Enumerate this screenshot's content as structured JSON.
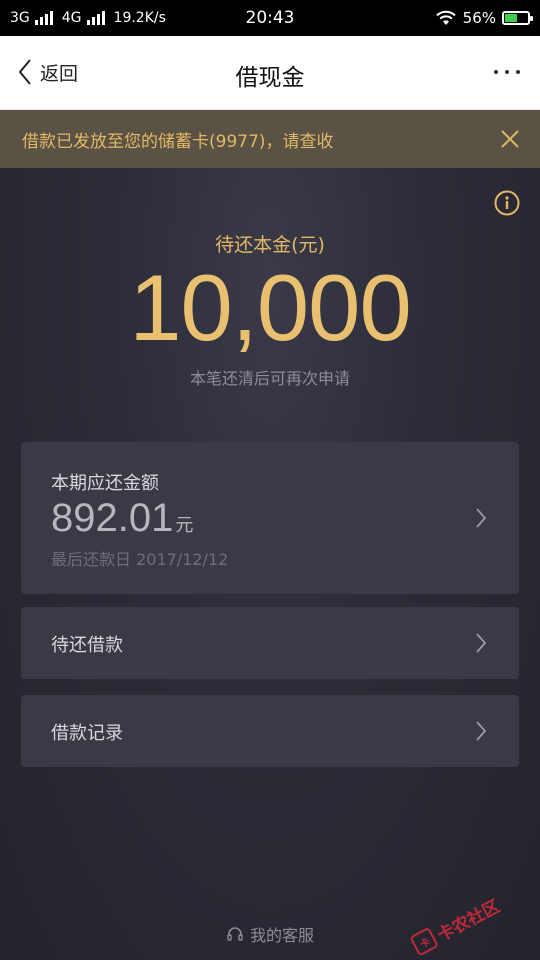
{
  "status_bar": {
    "network_left": "3G",
    "network_right": "4G",
    "speed": "19.2K/s",
    "time": "20:43",
    "battery": "56%",
    "battery_level": 0.56
  },
  "nav": {
    "back_label": "返回",
    "title": "借现金"
  },
  "notice": {
    "text": "借款已发放至您的储蓄卡(9977)，请查收"
  },
  "principal": {
    "label": "待还本金(元)",
    "amount": "10,000",
    "subtext": "本笔还清后可再次申请"
  },
  "current_period": {
    "title": "本期应还金额",
    "amount": "892.01",
    "unit": "元",
    "due_date": "最后还款日 2017/12/12"
  },
  "menu": {
    "pending_loans": "待还借款",
    "loan_records": "借款记录"
  },
  "footer": {
    "service_label": "我的客服"
  },
  "watermark": {
    "text": "卡农社区"
  },
  "colors": {
    "accent_gold": "#e9c070",
    "notice_bg": "#5a5245",
    "card_bg": "#3a3a46",
    "page_bg": "#2b2b36"
  }
}
